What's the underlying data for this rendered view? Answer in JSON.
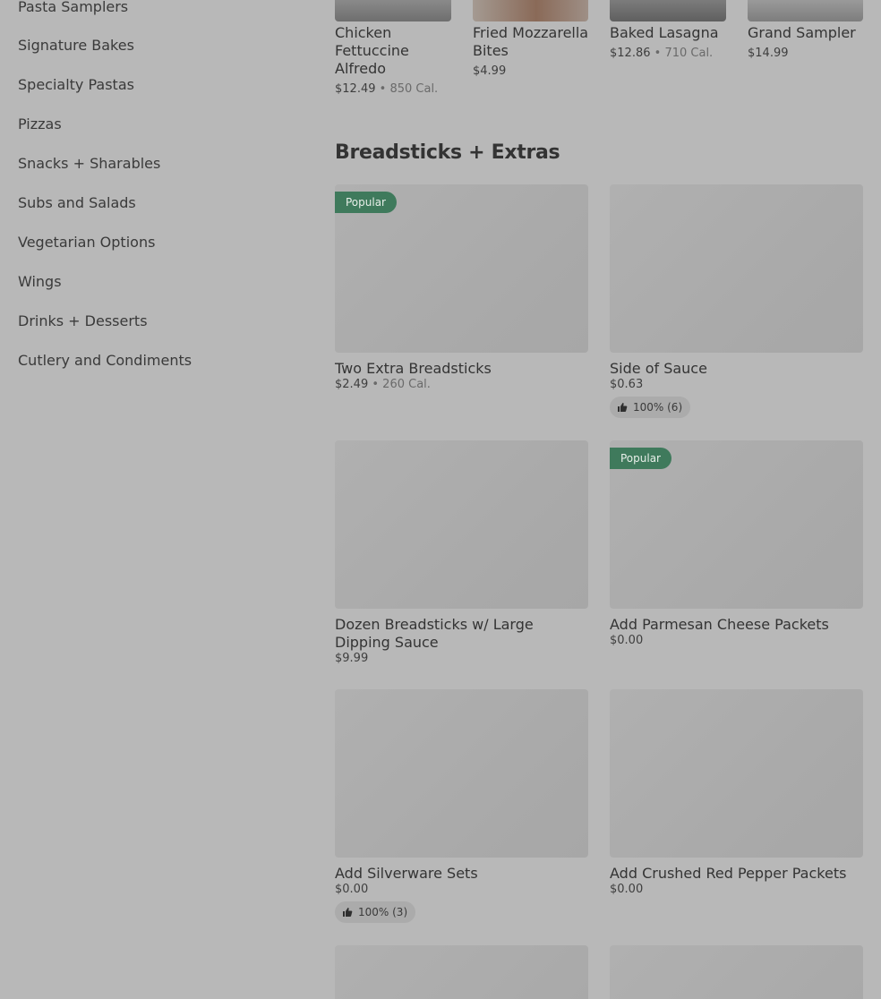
{
  "sidebar": {
    "items": [
      "Pasta Samplers",
      "Signature Bakes",
      "Specialty Pastas",
      "Pizzas",
      "Snacks + Sharables",
      "Subs and Salads",
      "Vegetarian Options",
      "Wings",
      "Drinks + Desserts",
      "Cutlery and Condiments"
    ]
  },
  "top_items": [
    {
      "name": "Chicken Fettuccine Alfredo",
      "price": "$12.49",
      "sep": "•",
      "cal": "850 Cal."
    },
    {
      "name": "Fried Mozzarella Bites",
      "price": "$4.99"
    },
    {
      "name": "Baked Lasagna",
      "price": "$12.86",
      "sep": "•",
      "cal": "710 Cal."
    },
    {
      "name": "Grand Sampler",
      "price": "$14.99"
    }
  ],
  "section": {
    "title": "Breadsticks + Extras"
  },
  "items": [
    {
      "name": "Two Extra Breadsticks",
      "price": "$2.49",
      "sep": "•",
      "cal": "260 Cal.",
      "badge": "Popular"
    },
    {
      "name": "Side of Sauce",
      "price": "$0.63",
      "rating": "100% (6)"
    },
    {
      "name": "Dozen Breadsticks w/ Large Dipping Sauce",
      "price": "$9.99"
    },
    {
      "name": "Add Parmesan Cheese Packets",
      "price": "$0.00",
      "badge": "Popular"
    },
    {
      "name": "Add Silverware Sets",
      "price": "$0.00",
      "rating": "100% (3)"
    },
    {
      "name": "Add Crushed Red Pepper Packets",
      "price": "$0.00"
    }
  ],
  "icons": {
    "thumbs_up": "thumbs-up-icon"
  },
  "colors": {
    "badge": "#3f7a5c",
    "background": "#b8b8b8"
  }
}
